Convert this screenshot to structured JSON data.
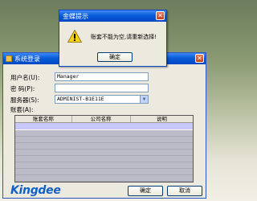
{
  "modal": {
    "title": "金蝶提示",
    "close_glyph": "✕",
    "icon": "warning-icon",
    "message": "账套不能为空,请重新选择!",
    "ok_label": "确定"
  },
  "login": {
    "title": "系统登录",
    "close_glyph": "✕",
    "username_label": "用户名(U):",
    "username_value": "Manager",
    "password_label": "密  码(P):",
    "password_value": "",
    "server_label": "服务器(S):",
    "server_value": "ADMINIST-B1E11E",
    "account_label": "账套(A):",
    "table_headers": [
      "账套名称",
      "公司名称",
      "说明"
    ],
    "brand_text": "Kingdee",
    "ok_label": "确定",
    "cancel_label": "取消"
  },
  "colors": {
    "titlebar": "#0a5bd8",
    "selected_row": "#c8c8ff",
    "brand": "#1060c8"
  }
}
